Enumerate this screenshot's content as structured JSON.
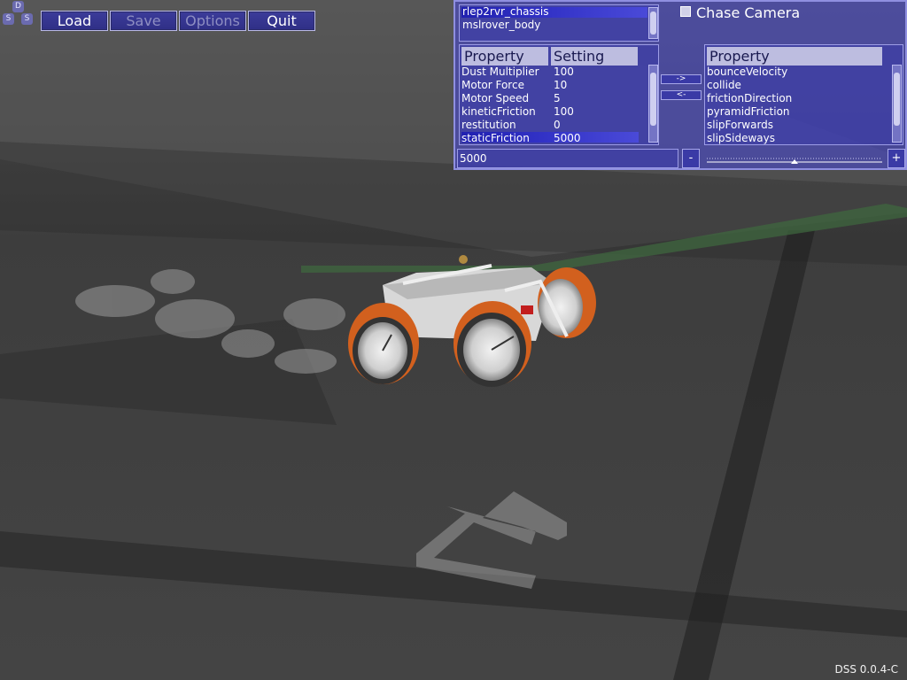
{
  "logo": {
    "letters": [
      "D",
      "S",
      "S"
    ]
  },
  "toolbar": {
    "buttons": [
      {
        "label": "Load",
        "enabled": true
      },
      {
        "label": "Save",
        "enabled": false
      },
      {
        "label": "Options",
        "enabled": false
      },
      {
        "label": "Quit",
        "enabled": true
      }
    ]
  },
  "panel": {
    "objects": [
      "rlep2rvr_chassis",
      "mslrover_body"
    ],
    "selected_object": 0,
    "chase_camera_label": "Chase Camera",
    "chase_camera_checked": false,
    "left_table": {
      "headers": [
        "Property",
        "Setting"
      ],
      "rows": [
        {
          "property": "Dust Multiplier",
          "setting": "100"
        },
        {
          "property": "Motor Force",
          "setting": "10"
        },
        {
          "property": "Motor Speed",
          "setting": "5"
        },
        {
          "property": "kineticFriction",
          "setting": "100"
        },
        {
          "property": "restitution",
          "setting": "0"
        },
        {
          "property": "staticFriction",
          "setting": "5000"
        }
      ],
      "selected_row": 5
    },
    "add_button": "->",
    "remove_button": "<-",
    "right_table": {
      "header": "Property",
      "rows": [
        "bounceVelocity",
        "collide",
        "frictionDirection",
        "pyramidFriction",
        "slipForwards",
        "slipSideways"
      ]
    },
    "value_field": "5000",
    "minus_label": "-",
    "plus_label": "+",
    "slider_value": 0.5
  },
  "version": "DSS 0.0.4-C",
  "colors": {
    "panel": "#4848c8",
    "button": "#2f2f86",
    "selection": "#2a2ab8"
  }
}
